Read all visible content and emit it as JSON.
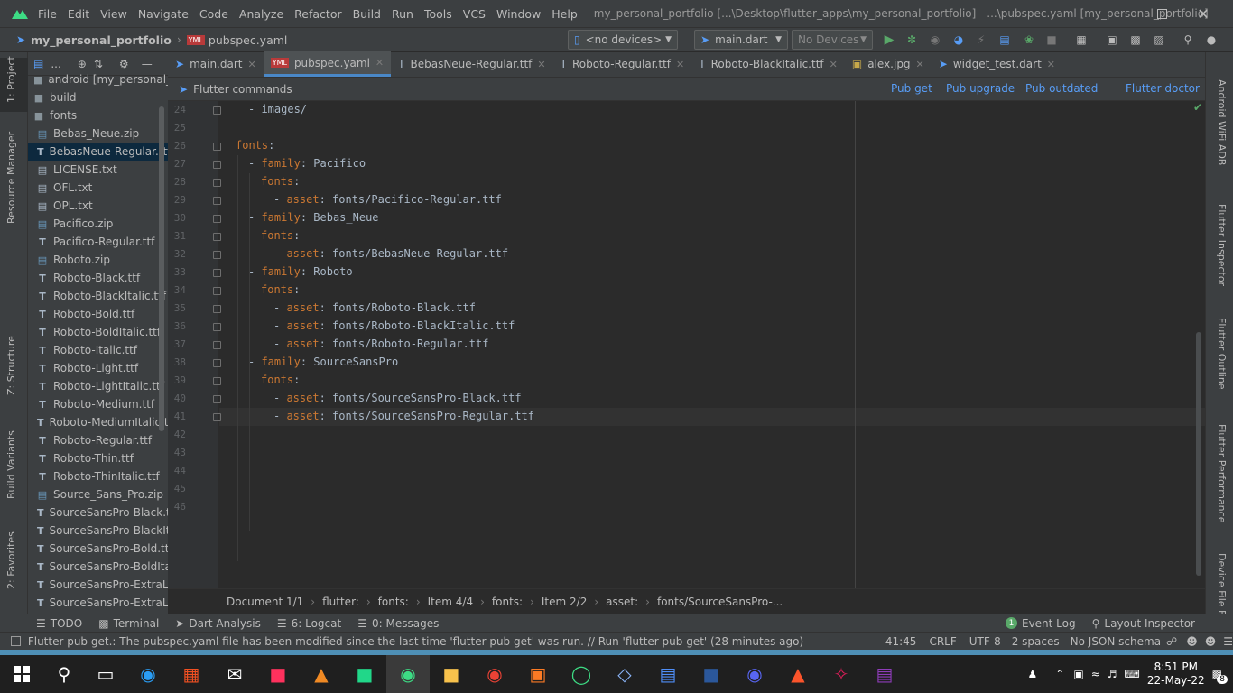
{
  "menu": [
    "File",
    "Edit",
    "View",
    "Navigate",
    "Code",
    "Analyze",
    "Refactor",
    "Build",
    "Run",
    "Tools",
    "VCS",
    "Window",
    "Help"
  ],
  "window_title": "my_personal_portfolio [...\\Desktop\\flutter_apps\\my_personal_portfolio] - ...\\pubspec.yaml [my_personal_portfolio]",
  "nav": {
    "project": "my_personal_portfolio",
    "file": "pubspec.yaml"
  },
  "toolbar": {
    "device": "<no devices>",
    "run_config": "main.dart",
    "device_select": "No Devices"
  },
  "left_tools": [
    "1: Project",
    "Resource Manager",
    "Z: Structure",
    "Build Variants",
    "2: Favorites"
  ],
  "right_tools": [
    "Android WiFi ADB",
    "Flutter Inspector",
    "Flutter Outline",
    "Flutter Performance",
    "Device File E"
  ],
  "project": {
    "header_label": "...",
    "rows": [
      {
        "label": "android [my_personal_port",
        "kind": "folder"
      },
      {
        "label": "build",
        "kind": "folder"
      },
      {
        "label": "fonts",
        "kind": "folder"
      },
      {
        "label": "Bebas_Neue.zip",
        "kind": "zip"
      },
      {
        "label": "BebasNeue-Regular.ttf",
        "kind": "ttf",
        "selected": true
      },
      {
        "label": "LICENSE.txt",
        "kind": "txt"
      },
      {
        "label": "OFL.txt",
        "kind": "txt"
      },
      {
        "label": "OPL.txt",
        "kind": "txt"
      },
      {
        "label": "Pacifico.zip",
        "kind": "zip"
      },
      {
        "label": "Pacifico-Regular.ttf",
        "kind": "ttf"
      },
      {
        "label": "Roboto.zip",
        "kind": "zip"
      },
      {
        "label": "Roboto-Black.ttf",
        "kind": "ttf"
      },
      {
        "label": "Roboto-BlackItalic.ttf",
        "kind": "ttf"
      },
      {
        "label": "Roboto-Bold.ttf",
        "kind": "ttf"
      },
      {
        "label": "Roboto-BoldItalic.ttf",
        "kind": "ttf"
      },
      {
        "label": "Roboto-Italic.ttf",
        "kind": "ttf"
      },
      {
        "label": "Roboto-Light.ttf",
        "kind": "ttf"
      },
      {
        "label": "Roboto-LightItalic.ttf",
        "kind": "ttf"
      },
      {
        "label": "Roboto-Medium.ttf",
        "kind": "ttf"
      },
      {
        "label": "Roboto-MediumItalic.ttf",
        "kind": "ttf"
      },
      {
        "label": "Roboto-Regular.ttf",
        "kind": "ttf"
      },
      {
        "label": "Roboto-Thin.ttf",
        "kind": "ttf"
      },
      {
        "label": "Roboto-ThinItalic.ttf",
        "kind": "ttf"
      },
      {
        "label": "Source_Sans_Pro.zip",
        "kind": "zip"
      },
      {
        "label": "SourceSansPro-Black.ttf",
        "kind": "ttf"
      },
      {
        "label": "SourceSansPro-BlackItali",
        "kind": "ttf"
      },
      {
        "label": "SourceSansPro-Bold.ttf",
        "kind": "ttf"
      },
      {
        "label": "SourceSansPro-BoldItalic",
        "kind": "ttf"
      },
      {
        "label": "SourceSansPro-ExtraLigh",
        "kind": "ttf"
      },
      {
        "label": "SourceSansPro-ExtraLigh",
        "kind": "ttf"
      }
    ]
  },
  "tabs": [
    {
      "label": "main.dart",
      "icon": "dart"
    },
    {
      "label": "pubspec.yaml",
      "icon": "yaml",
      "active": true
    },
    {
      "label": "BebasNeue-Regular.ttf",
      "icon": "ttf"
    },
    {
      "label": "Roboto-Regular.ttf",
      "icon": "ttf"
    },
    {
      "label": "Roboto-BlackItalic.ttf",
      "icon": "ttf"
    },
    {
      "label": "alex.jpg",
      "icon": "img"
    },
    {
      "label": "widget_test.dart",
      "icon": "dart"
    }
  ],
  "flutter_commands": {
    "title": "Flutter commands",
    "links": [
      "Pub get",
      "Pub upgrade",
      "Pub outdated",
      "Flutter doctor"
    ]
  },
  "code_lines": [
    {
      "n": "24",
      "indent": 1,
      "dash": true,
      "key": "",
      "val": "images/"
    },
    {
      "n": "25",
      "indent": 0,
      "dash": false,
      "key": "",
      "val": ""
    },
    {
      "n": "26",
      "indent": 0,
      "dash": false,
      "key": "fonts",
      "val": ""
    },
    {
      "n": "27",
      "indent": 1,
      "dash": true,
      "key": "family",
      "val": "Pacifico"
    },
    {
      "n": "28",
      "indent": 2,
      "dash": false,
      "key": "fonts",
      "val": ""
    },
    {
      "n": "29",
      "indent": 3,
      "dash": true,
      "key": "asset",
      "val": "fonts/Pacifico-Regular.ttf"
    },
    {
      "n": "30",
      "indent": 1,
      "dash": true,
      "key": "family",
      "val": "Bebas_Neue"
    },
    {
      "n": "31",
      "indent": 2,
      "dash": false,
      "key": "fonts",
      "val": ""
    },
    {
      "n": "32",
      "indent": 3,
      "dash": true,
      "key": "asset",
      "val": "fonts/BebasNeue-Regular.ttf"
    },
    {
      "n": "33",
      "indent": 1,
      "dash": true,
      "key": "family",
      "val": "Roboto"
    },
    {
      "n": "34",
      "indent": 2,
      "dash": false,
      "key": "fonts",
      "val": ""
    },
    {
      "n": "35",
      "indent": 3,
      "dash": true,
      "key": "asset",
      "val": "fonts/Roboto-Black.ttf"
    },
    {
      "n": "36",
      "indent": 3,
      "dash": true,
      "key": "asset",
      "val": "fonts/Roboto-BlackItalic.ttf"
    },
    {
      "n": "37",
      "indent": 3,
      "dash": true,
      "key": "asset",
      "val": "fonts/Roboto-Regular.ttf"
    },
    {
      "n": "38",
      "indent": 1,
      "dash": true,
      "key": "family",
      "val": "SourceSansPro"
    },
    {
      "n": "39",
      "indent": 2,
      "dash": false,
      "key": "fonts",
      "val": ""
    },
    {
      "n": "40",
      "indent": 3,
      "dash": true,
      "key": "asset",
      "val": "fonts/SourceSansPro-Black.ttf"
    },
    {
      "n": "41",
      "indent": 3,
      "dash": true,
      "key": "asset",
      "val": "fonts/SourceSansPro-Regular.ttf"
    },
    {
      "n": "42",
      "indent": 0,
      "dash": false,
      "key": "",
      "val": ""
    },
    {
      "n": "43",
      "indent": 0,
      "dash": false,
      "key": "",
      "val": ""
    },
    {
      "n": "44",
      "indent": 0,
      "dash": false,
      "key": "",
      "val": ""
    },
    {
      "n": "45",
      "indent": 0,
      "dash": false,
      "key": "",
      "val": ""
    },
    {
      "n": "46",
      "indent": 0,
      "dash": false,
      "key": "",
      "val": ""
    }
  ],
  "editor_breadcrumb": [
    "Document 1/1",
    "flutter:",
    "fonts:",
    "Item 4/4",
    "fonts:",
    "Item 2/2",
    "asset:",
    "fonts/SourceSansPro-..."
  ],
  "bottom_tools": {
    "todo": "TODO",
    "terminal": "Terminal",
    "dart_analysis": "Dart Analysis",
    "logcat": "6: Logcat",
    "messages": "0: Messages",
    "event_log": "Event Log",
    "event_count": "1",
    "layout_inspector": "Layout Inspector"
  },
  "status": {
    "message": "Flutter pub get.: The pubspec.yaml file has been modified since the last time 'flutter pub get' was run. // Run 'flutter pub get' (28 minutes ago)",
    "position": "41:45",
    "line_sep": "CRLF",
    "encoding": "UTF-8",
    "indent": "2 spaces",
    "schema": "No JSON schema"
  },
  "taskbar": {
    "time": "8:51 PM",
    "date": "22-May-22",
    "notifications": "8",
    "apps": [
      "search",
      "task-view",
      "edge",
      "store",
      "mail",
      "intellij",
      "vlc",
      "pycharm",
      "android-studio",
      "explorer",
      "chrome",
      "xampp",
      "circle-app",
      "notes",
      "word-viewer",
      "word",
      "discord",
      "brave",
      "slack",
      "winrar"
    ]
  },
  "colors": {
    "keyword": "#cc7832",
    "text": "#a9b7c6",
    "link": "#589df6",
    "bg": "#2b2b2b",
    "panel": "#3c3f41"
  }
}
